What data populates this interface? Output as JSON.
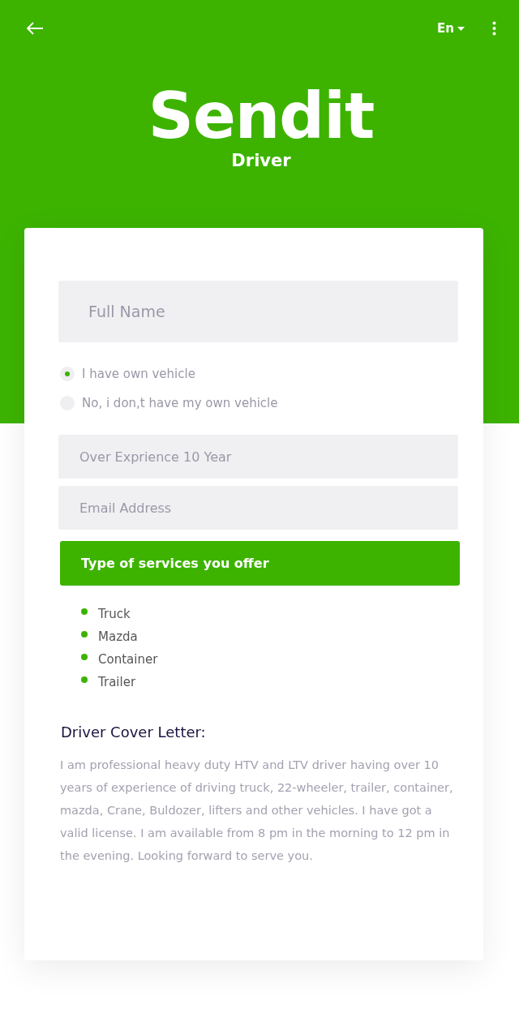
{
  "header": {
    "language": "En",
    "logo": "Sendit",
    "subtitle": "Driver"
  },
  "form": {
    "full_name": {
      "placeholder": "Full Name"
    },
    "vehicle_options": [
      {
        "label": "I have own vehicle",
        "selected": true
      },
      {
        "label": "No, i don,t have my own vehicle",
        "selected": false
      }
    ],
    "experience": {
      "placeholder": "Over Exprience 10 Year"
    },
    "email": {
      "placeholder": "Email Address"
    },
    "services_button": "Type of services you offer",
    "services": [
      "Truck",
      "Mazda",
      "Container",
      "Trailer"
    ],
    "cover_letter": {
      "title": "Driver Cover Letter:",
      "text": "I am professional heavy duty HTV and LTV driver having over 10 years of experience of driving truck, 22-wheeler, trailer, container, mazda, Crane, Buldozer, lifters and other vehicles. I have got a valid license. I am available from 8 pm in the morning to 12 pm in the evening. Looking forward to serve you."
    }
  }
}
